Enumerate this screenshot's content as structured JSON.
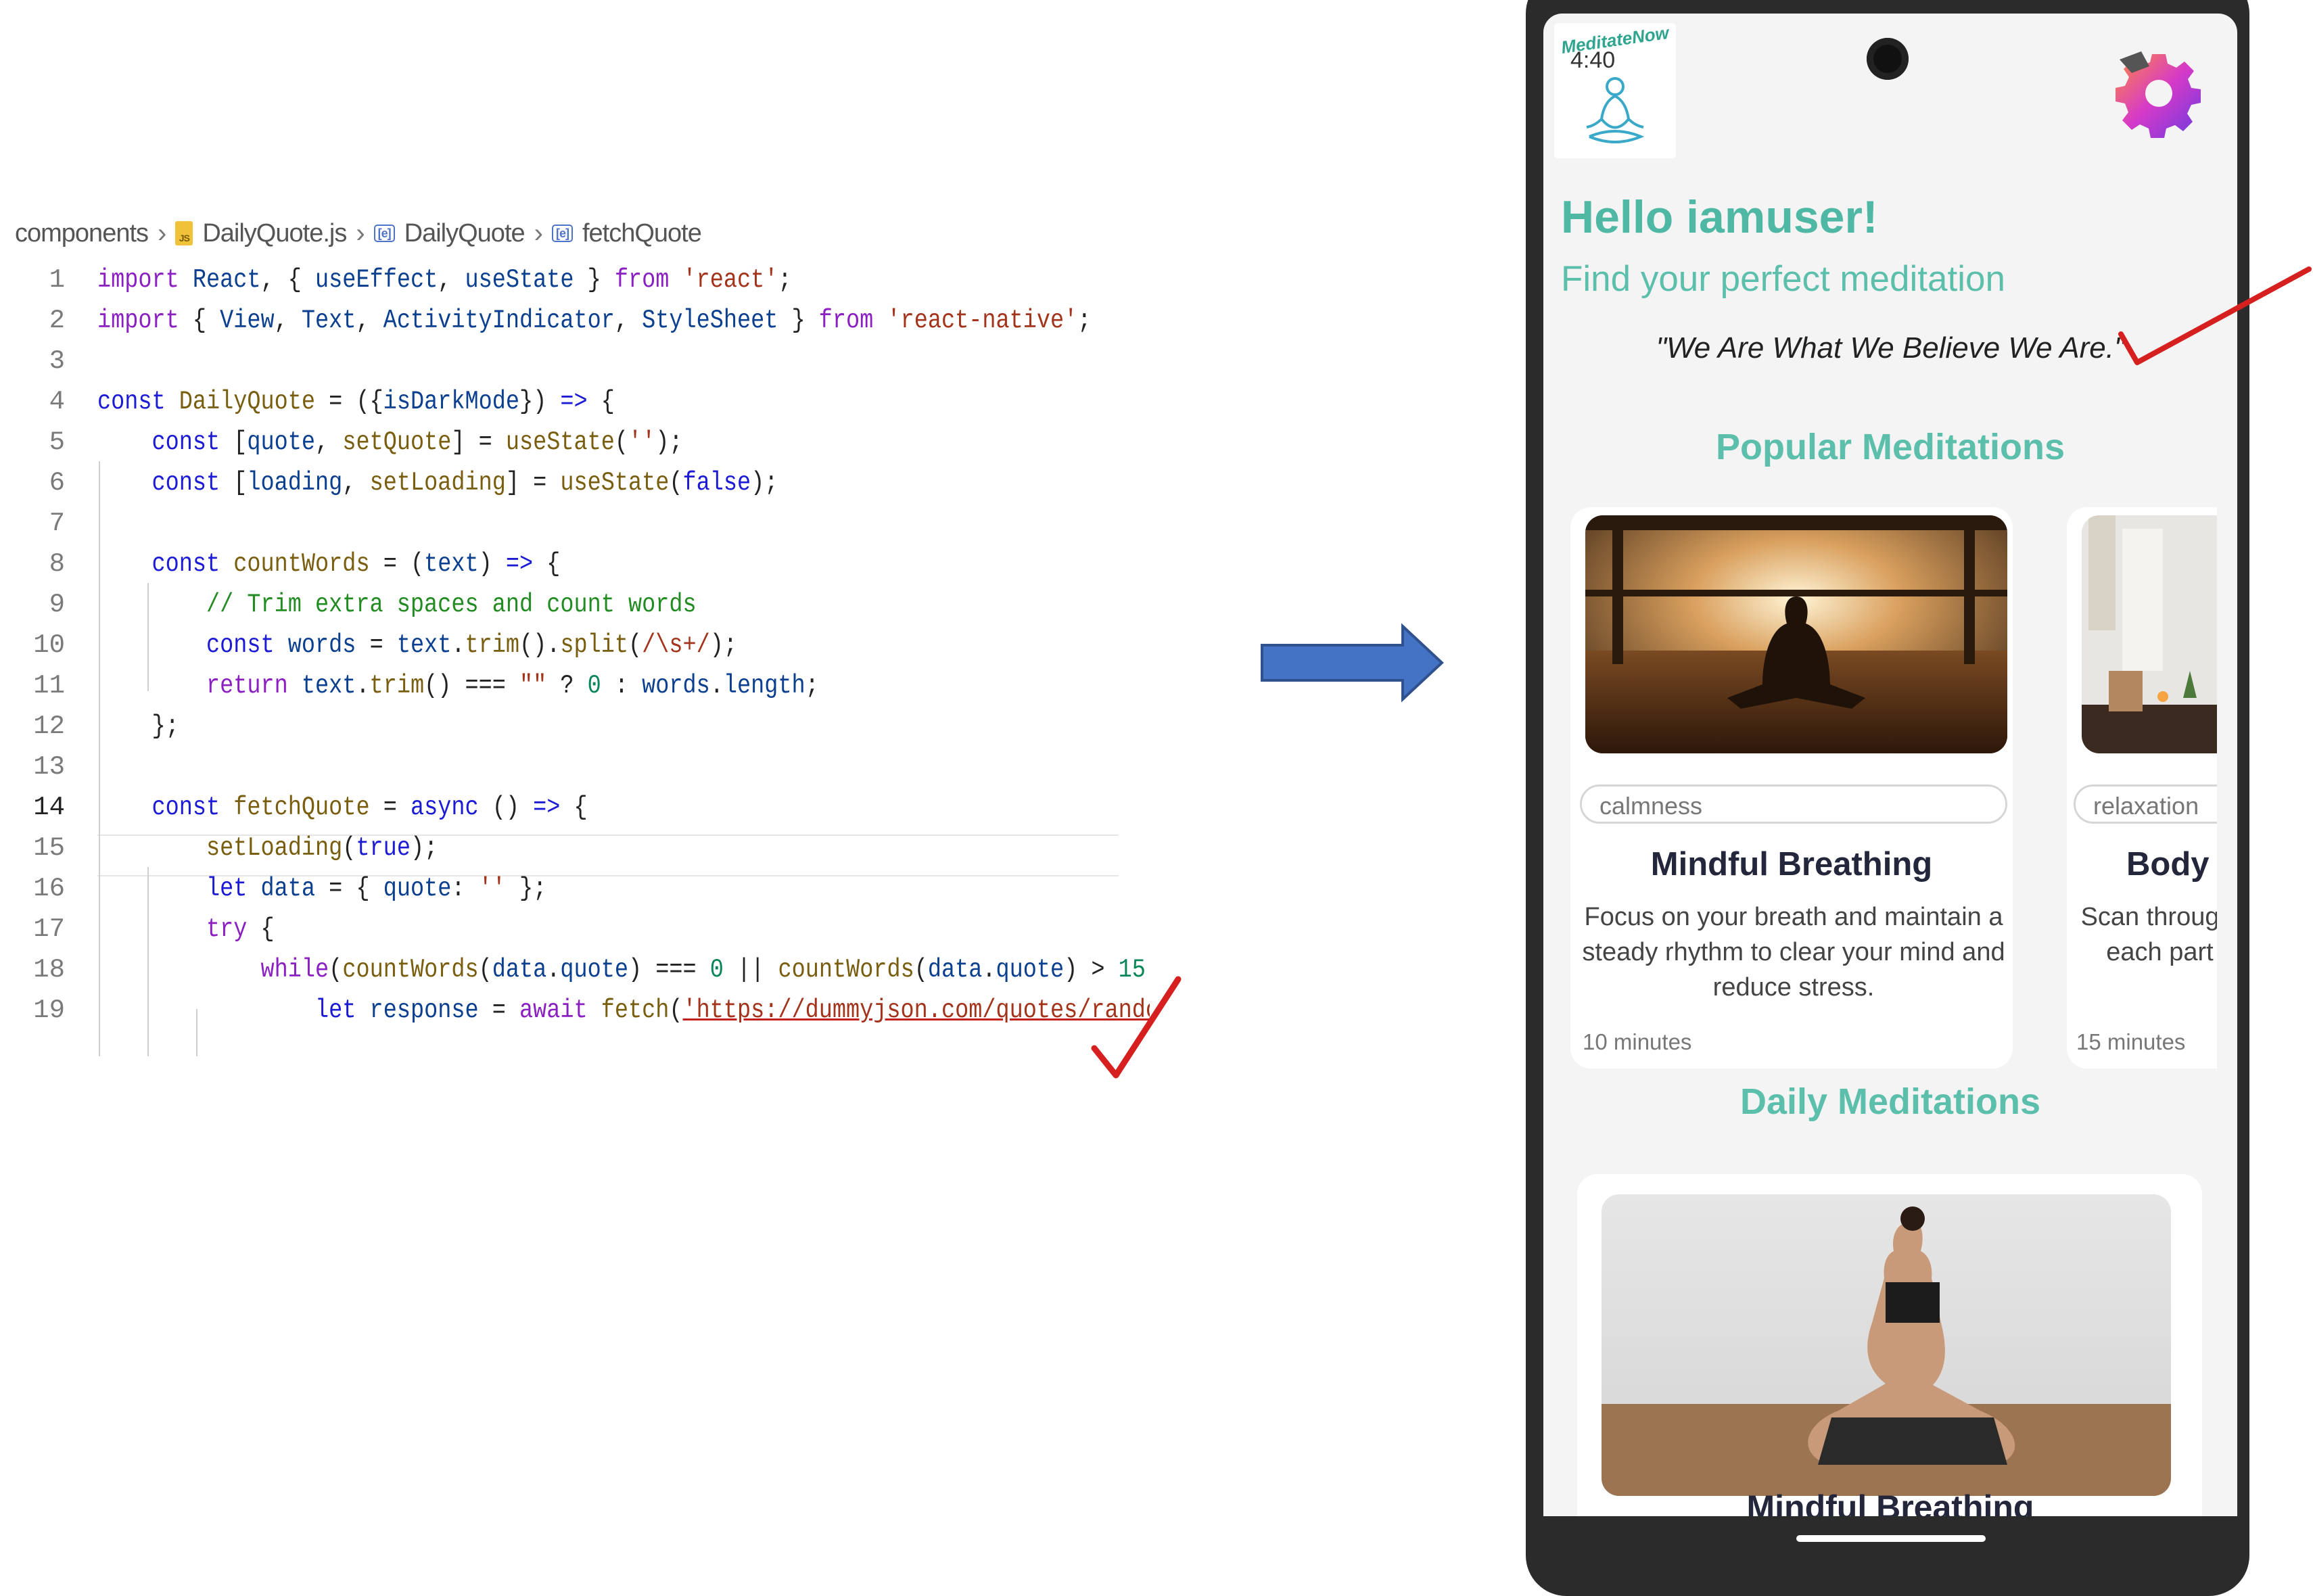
{
  "editor": {
    "breadcrumb": [
      "components",
      "DailyQuote.js",
      "DailyQuote",
      "fetchQuote"
    ],
    "js_badge": "JS",
    "sym_badge": "[e]",
    "line_numbers": [
      "1",
      "2",
      "3",
      "4",
      "5",
      "6",
      "7",
      "8",
      "9",
      "10",
      "11",
      "12",
      "13",
      "14",
      "15",
      "16",
      "17",
      "18",
      "19"
    ],
    "active_line": "14",
    "lines": [
      [
        [
          "kw2",
          "import "
        ],
        [
          "vr",
          "React"
        ],
        [
          "pl",
          ", { "
        ],
        [
          "vr",
          "useEffect"
        ],
        [
          "pl",
          ", "
        ],
        [
          "vr",
          "useState"
        ],
        [
          "pl",
          " } "
        ],
        [
          "kw2",
          "from "
        ],
        [
          "st",
          "'react'"
        ],
        [
          "pl",
          ";"
        ]
      ],
      [
        [
          "kw2",
          "import "
        ],
        [
          "pl",
          "{ "
        ],
        [
          "vr",
          "View"
        ],
        [
          "pl",
          ", "
        ],
        [
          "vr",
          "Text"
        ],
        [
          "pl",
          ", "
        ],
        [
          "vr",
          "ActivityIndicator"
        ],
        [
          "pl",
          ", "
        ],
        [
          "vr",
          "StyleSheet"
        ],
        [
          "pl",
          " } "
        ],
        [
          "kw2",
          "from "
        ],
        [
          "st",
          "'react-native'"
        ],
        [
          "pl",
          ";"
        ]
      ],
      [],
      [
        [
          "kw",
          "const "
        ],
        [
          "fn",
          "DailyQuote"
        ],
        [
          "pl",
          " = ({"
        ],
        [
          "vr",
          "isDarkMode"
        ],
        [
          "pl",
          "}) "
        ],
        [
          "kw",
          "=>"
        ],
        [
          "pl",
          " {"
        ]
      ],
      [
        [
          "pl",
          "    "
        ],
        [
          "kw",
          "const "
        ],
        [
          "pl",
          "["
        ],
        [
          "vr",
          "quote"
        ],
        [
          "pl",
          ", "
        ],
        [
          "fn",
          "setQuote"
        ],
        [
          "pl",
          "] = "
        ],
        [
          "fn",
          "useState"
        ],
        [
          "pl",
          "("
        ],
        [
          "st",
          "''"
        ],
        [
          "pl",
          ");"
        ]
      ],
      [
        [
          "pl",
          "    "
        ],
        [
          "kw",
          "const "
        ],
        [
          "pl",
          "["
        ],
        [
          "vr",
          "loading"
        ],
        [
          "pl",
          ", "
        ],
        [
          "fn",
          "setLoading"
        ],
        [
          "pl",
          "] = "
        ],
        [
          "fn",
          "useState"
        ],
        [
          "pl",
          "("
        ],
        [
          "kw",
          "false"
        ],
        [
          "pl",
          ");"
        ]
      ],
      [],
      [
        [
          "pl",
          "    "
        ],
        [
          "kw",
          "const "
        ],
        [
          "fn",
          "countWords"
        ],
        [
          "pl",
          " = ("
        ],
        [
          "vr",
          "text"
        ],
        [
          "pl",
          ") "
        ],
        [
          "kw",
          "=>"
        ],
        [
          "pl",
          " {"
        ]
      ],
      [
        [
          "pl",
          "        "
        ],
        [
          "cm",
          "// Trim extra spaces and count words"
        ]
      ],
      [
        [
          "pl",
          "        "
        ],
        [
          "kw",
          "const "
        ],
        [
          "vr",
          "words"
        ],
        [
          "pl",
          " = "
        ],
        [
          "vr",
          "text"
        ],
        [
          "pl",
          "."
        ],
        [
          "fn",
          "trim"
        ],
        [
          "pl",
          "()."
        ],
        [
          "fn",
          "split"
        ],
        [
          "pl",
          "("
        ],
        [
          "st",
          "/\\s+/"
        ],
        [
          "pl",
          ");"
        ]
      ],
      [
        [
          "pl",
          "        "
        ],
        [
          "kw2",
          "return "
        ],
        [
          "vr",
          "text"
        ],
        [
          "pl",
          "."
        ],
        [
          "fn",
          "trim"
        ],
        [
          "pl",
          "() === "
        ],
        [
          "st",
          "\"\""
        ],
        [
          "pl",
          " ? "
        ],
        [
          "nm",
          "0"
        ],
        [
          "pl",
          " : "
        ],
        [
          "vr",
          "words"
        ],
        [
          "pl",
          "."
        ],
        [
          "vr",
          "length"
        ],
        [
          "pl",
          ";"
        ]
      ],
      [
        [
          "pl",
          "    };"
        ]
      ],
      [],
      [
        [
          "pl",
          "    "
        ],
        [
          "kw",
          "const "
        ],
        [
          "fn",
          "fetchQuote"
        ],
        [
          "pl",
          " = "
        ],
        [
          "kw",
          "async "
        ],
        [
          "pl",
          "() "
        ],
        [
          "kw",
          "=>"
        ],
        [
          "pl",
          " {"
        ]
      ],
      [
        [
          "pl",
          "        "
        ],
        [
          "fn",
          "setLoading"
        ],
        [
          "pl",
          "("
        ],
        [
          "kw",
          "true"
        ],
        [
          "pl",
          ");"
        ]
      ],
      [
        [
          "pl",
          "        "
        ],
        [
          "kw",
          "let "
        ],
        [
          "vr",
          "data"
        ],
        [
          "pl",
          " = { "
        ],
        [
          "vr",
          "quote"
        ],
        [
          "pl",
          ": "
        ],
        [
          "st",
          "''"
        ],
        [
          "pl",
          " };"
        ]
      ],
      [
        [
          "pl",
          "        "
        ],
        [
          "kw2",
          "try "
        ],
        [
          "pl",
          "{"
        ]
      ],
      [
        [
          "pl",
          "            "
        ],
        [
          "kw2",
          "while"
        ],
        [
          "pl",
          "("
        ],
        [
          "fn",
          "countWords"
        ],
        [
          "pl",
          "("
        ],
        [
          "vr",
          "data"
        ],
        [
          "pl",
          "."
        ],
        [
          "vr",
          "quote"
        ],
        [
          "pl",
          ") === "
        ],
        [
          "nm",
          "0"
        ],
        [
          "pl",
          " || "
        ],
        [
          "fn",
          "countWords"
        ],
        [
          "pl",
          "("
        ],
        [
          "vr",
          "data"
        ],
        [
          "pl",
          "."
        ],
        [
          "vr",
          "quote"
        ],
        [
          "pl",
          ") > "
        ],
        [
          "nm",
          "15"
        ],
        [
          "pl",
          " ) {"
        ]
      ],
      [
        [
          "pl",
          "                "
        ],
        [
          "kw",
          "let "
        ],
        [
          "vr",
          "response"
        ],
        [
          "pl",
          " = "
        ],
        [
          "kw2",
          "await "
        ],
        [
          "fn",
          "fetch"
        ],
        [
          "pl",
          "("
        ],
        [
          "stu",
          "'https://dummyjson.com/quotes/random'"
        ],
        [
          "pl",
          ");"
        ]
      ]
    ]
  },
  "app": {
    "logo_text": "MeditateNow",
    "clock": "4:40",
    "greeting": "Hello iamuser!",
    "subtitle": "Find your perfect meditation",
    "quote": "\"We Are What We Believe We Are.\"",
    "popular_title": "Popular Meditations",
    "daily_title": "Daily Meditations",
    "cards": [
      {
        "tag": "calmness",
        "title": "Mindful Breathing",
        "desc": "Focus on your breath and maintain a steady rhythm to clear your mind and reduce stress.",
        "duration": "10 minutes"
      },
      {
        "tag": "relaxation",
        "title": "Body Scan",
        "desc": "Scan through your body, relaxing each part to release tension.",
        "duration": "15 minutes"
      }
    ],
    "daily_card_title": "Mindful Breathing"
  },
  "colors": {
    "accent": "#5cbfac",
    "card_title": "#24263b",
    "check": "#d62020",
    "arrow": "#4472c4"
  }
}
